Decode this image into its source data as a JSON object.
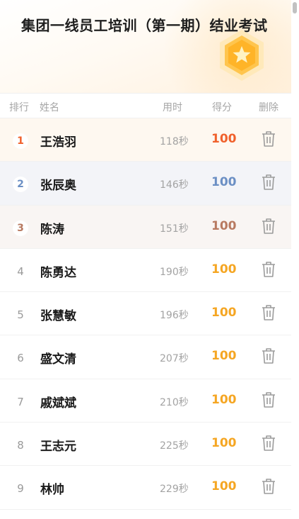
{
  "header": {
    "title": "集团一线员工培训（第一期）结业考试"
  },
  "columns": {
    "rank": "排行",
    "name": "姓名",
    "time": "用时",
    "score": "得分",
    "delete": "删除"
  },
  "colors": {
    "gold": "#f0612c",
    "silver": "#6b8fc4",
    "bronze": "#b87a61",
    "score": "#f5a623"
  },
  "rows": [
    {
      "rank": "1",
      "name": "王浩羽",
      "time": "118秒",
      "score": "100"
    },
    {
      "rank": "2",
      "name": "张辰奥",
      "time": "146秒",
      "score": "100"
    },
    {
      "rank": "3",
      "name": "陈涛",
      "time": "151秒",
      "score": "100"
    },
    {
      "rank": "4",
      "name": "陈勇达",
      "time": "190秒",
      "score": "100"
    },
    {
      "rank": "5",
      "name": "张慧敏",
      "time": "196秒",
      "score": "100"
    },
    {
      "rank": "6",
      "name": "盛文清",
      "time": "207秒",
      "score": "100"
    },
    {
      "rank": "7",
      "name": "戚斌斌",
      "time": "210秒",
      "score": "100"
    },
    {
      "rank": "8",
      "name": "王志元",
      "time": "225秒",
      "score": "100"
    },
    {
      "rank": "9",
      "name": "林帅",
      "time": "229秒",
      "score": "100"
    }
  ]
}
